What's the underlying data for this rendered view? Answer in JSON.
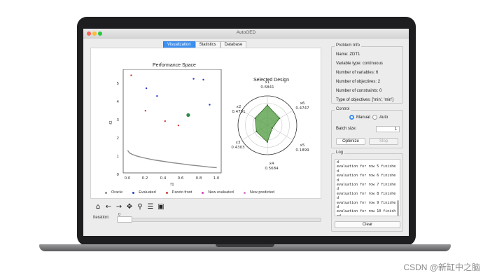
{
  "window": {
    "title": "AutoOED"
  },
  "tabs": [
    {
      "label": "Visualization",
      "active": true
    },
    {
      "label": "Statistics",
      "active": false
    },
    {
      "label": "Database",
      "active": false
    }
  ],
  "performance_plot": {
    "title": "Performance Space",
    "xlabel": "f1",
    "ylabel": "f2",
    "xticks": [
      "0.0",
      "0.2",
      "0.4",
      "0.6",
      "0.8",
      "1.0"
    ],
    "yticks": [
      "0",
      "1",
      "2",
      "3",
      "4",
      "5"
    ]
  },
  "radar": {
    "title": "Selected Design",
    "axes": [
      {
        "name": "x1",
        "value": "0.6841"
      },
      {
        "name": "x6",
        "value": "0.4747"
      },
      {
        "name": "x5",
        "value": "0.1899"
      },
      {
        "name": "x4",
        "value": "0.5684"
      },
      {
        "name": "x3",
        "value": "0.4303"
      },
      {
        "name": "x2",
        "value": "0.4791"
      }
    ]
  },
  "chart_data": [
    {
      "type": "scatter",
      "title": "Performance Space",
      "xlabel": "f1",
      "ylabel": "f2",
      "xlim": [
        -0.05,
        1.05
      ],
      "ylim": [
        -0.3,
        5.7
      ],
      "grid": false,
      "legend_position": "bottom",
      "series": [
        {
          "name": "Oracle",
          "color": "#8c8c8c",
          "line": true,
          "points": [
            [
              0.0,
              1.0
            ],
            [
              0.02,
              0.86
            ],
            [
              0.05,
              0.78
            ],
            [
              0.1,
              0.68
            ],
            [
              0.15,
              0.61
            ],
            [
              0.2,
              0.55
            ],
            [
              0.3,
              0.45
            ],
            [
              0.4,
              0.37
            ],
            [
              0.5,
              0.29
            ],
            [
              0.6,
              0.23
            ],
            [
              0.7,
              0.16
            ],
            [
              0.8,
              0.11
            ],
            [
              0.9,
              0.05
            ],
            [
              1.0,
              0.0
            ]
          ]
        },
        {
          "name": "Evaluated",
          "color": "#2a3bcc",
          "points": [
            [
              0.21,
              4.6
            ],
            [
              0.33,
              4.15
            ],
            [
              0.74,
              5.15
            ],
            [
              0.85,
              5.1
            ],
            [
              0.92,
              3.65
            ]
          ]
        },
        {
          "name": "Pareto front",
          "color": "#d43c3c",
          "points": [
            [
              0.04,
              5.35
            ],
            [
              0.2,
              3.3
            ],
            [
              0.42,
              2.7
            ],
            [
              0.57,
              2.45
            ]
          ]
        },
        {
          "name": "New evaluated",
          "color": "#d43cb0",
          "points": []
        },
        {
          "name": "New predicted",
          "color": "#d97ad6",
          "points": []
        }
      ],
      "selected_point": {
        "x": 0.68,
        "y": 3.05,
        "color": "#2e8b4a"
      }
    },
    {
      "type": "radar",
      "title": "Selected Design",
      "categories": [
        "x1",
        "x6",
        "x5",
        "x4",
        "x3",
        "x2"
      ],
      "values": [
        0.6841,
        0.4747,
        0.1899,
        0.5684,
        0.4303,
        0.4791
      ],
      "range": [
        0,
        1
      ],
      "fill_color": "#4c9a3c"
    }
  ],
  "legend": [
    {
      "label": "Oracle",
      "color": "#8c8c8c"
    },
    {
      "label": "Evaluated",
      "color": "#2a3bcc"
    },
    {
      "label": "Pareto front",
      "color": "#d43c3c"
    },
    {
      "label": "New evaluated",
      "color": "#d43cb0"
    },
    {
      "label": "New predicted",
      "color": "#d97ad6"
    }
  ],
  "toolbar": {
    "icons": [
      "home-icon",
      "back-arrow-icon",
      "forward-arrow-icon",
      "pan-icon",
      "zoom-icon",
      "configure-subplots-icon",
      "save-icon"
    ],
    "glyphs": [
      "⌂",
      "←",
      "→",
      "✥",
      "⚲",
      "☰",
      "▣"
    ]
  },
  "iteration": {
    "label": "Iteration:",
    "value": "0",
    "progress": 0
  },
  "problem_info": {
    "title": "Problem Info",
    "name": "Name: ZDT1",
    "variable_type": "Variable type: continuous",
    "num_variables": "Number of variables: 6",
    "num_objectives": "Number of objectives: 2",
    "num_constraints": "Number of constraints: 0",
    "objective_types": "Type of objectives: ['min', 'min']"
  },
  "control": {
    "title": "Control",
    "manual_label": "Manual",
    "auto_label": "Auto",
    "mode": "Manual",
    "batch_label": "Batch size:",
    "batch_value": "1",
    "optimize_label": "Optimize",
    "stop_label": "Stop"
  },
  "log": {
    "title": "Log",
    "lines": [
      "d",
      "evaluation for row 5 finishe",
      "d",
      "evaluation for row 6 finishe",
      "d",
      "evaluation for row 7 finishe",
      "d",
      "evaluation for row 8 finishe",
      "d",
      "evaluation for row 9 finishe",
      "d",
      "evaluation for row 10 finish",
      "ed"
    ],
    "clear_label": "Clear"
  },
  "watermark": "CSDN @新缸中之脑",
  "colors": {
    "accent": "#3d8ff0",
    "frame": "#1e1e20"
  }
}
